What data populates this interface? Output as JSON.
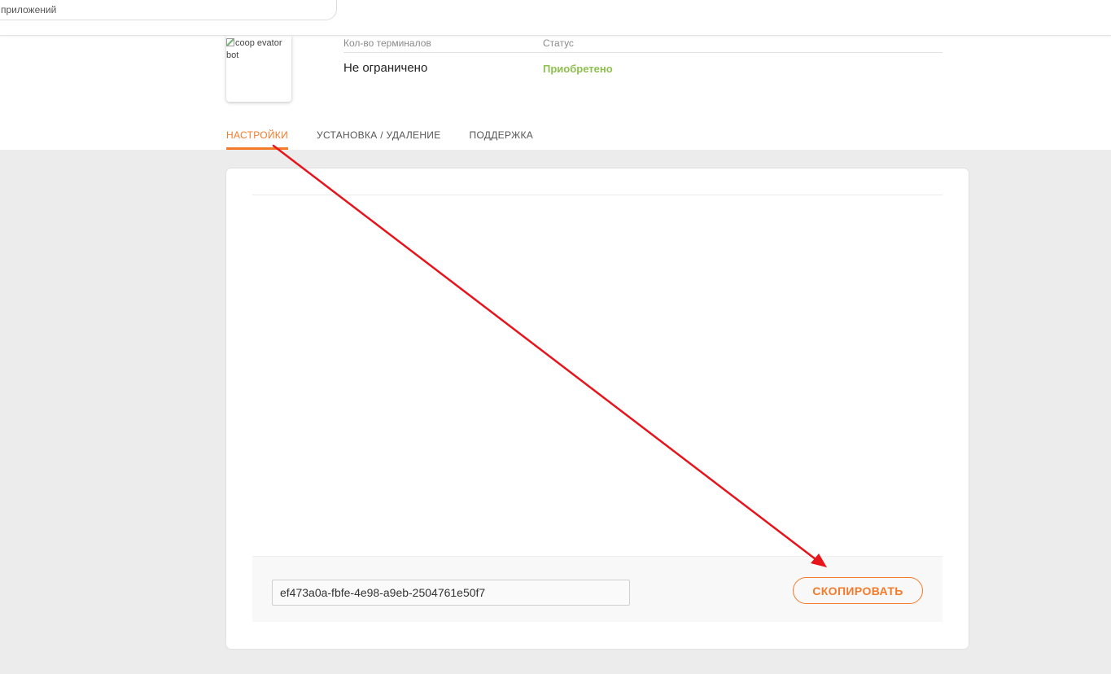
{
  "search": {
    "placeholder": "приложений"
  },
  "app": {
    "logo_alt": "coop evator bot",
    "info_headers": {
      "terminals": "Кол-во терминалов",
      "status": "Статус"
    },
    "terminals_value": "Не ограничено",
    "status_value": "Приобретено"
  },
  "tabs": [
    {
      "label": "НАСТРОЙКИ",
      "active": true
    },
    {
      "label": "УСТАНОВКА / УДАЛЕНИЕ",
      "active": false
    },
    {
      "label": "ПОДДЕРЖКА",
      "active": false
    }
  ],
  "settings": {
    "key_value": "ef473a0a-fbfe-4e98-a9eb-2504761e50f7",
    "copy_label": "СКОПИРОВАТЬ"
  },
  "colors": {
    "accent": "#f47a2a",
    "status_green": "#8dc14d",
    "annotation_red": "#e8141b"
  }
}
